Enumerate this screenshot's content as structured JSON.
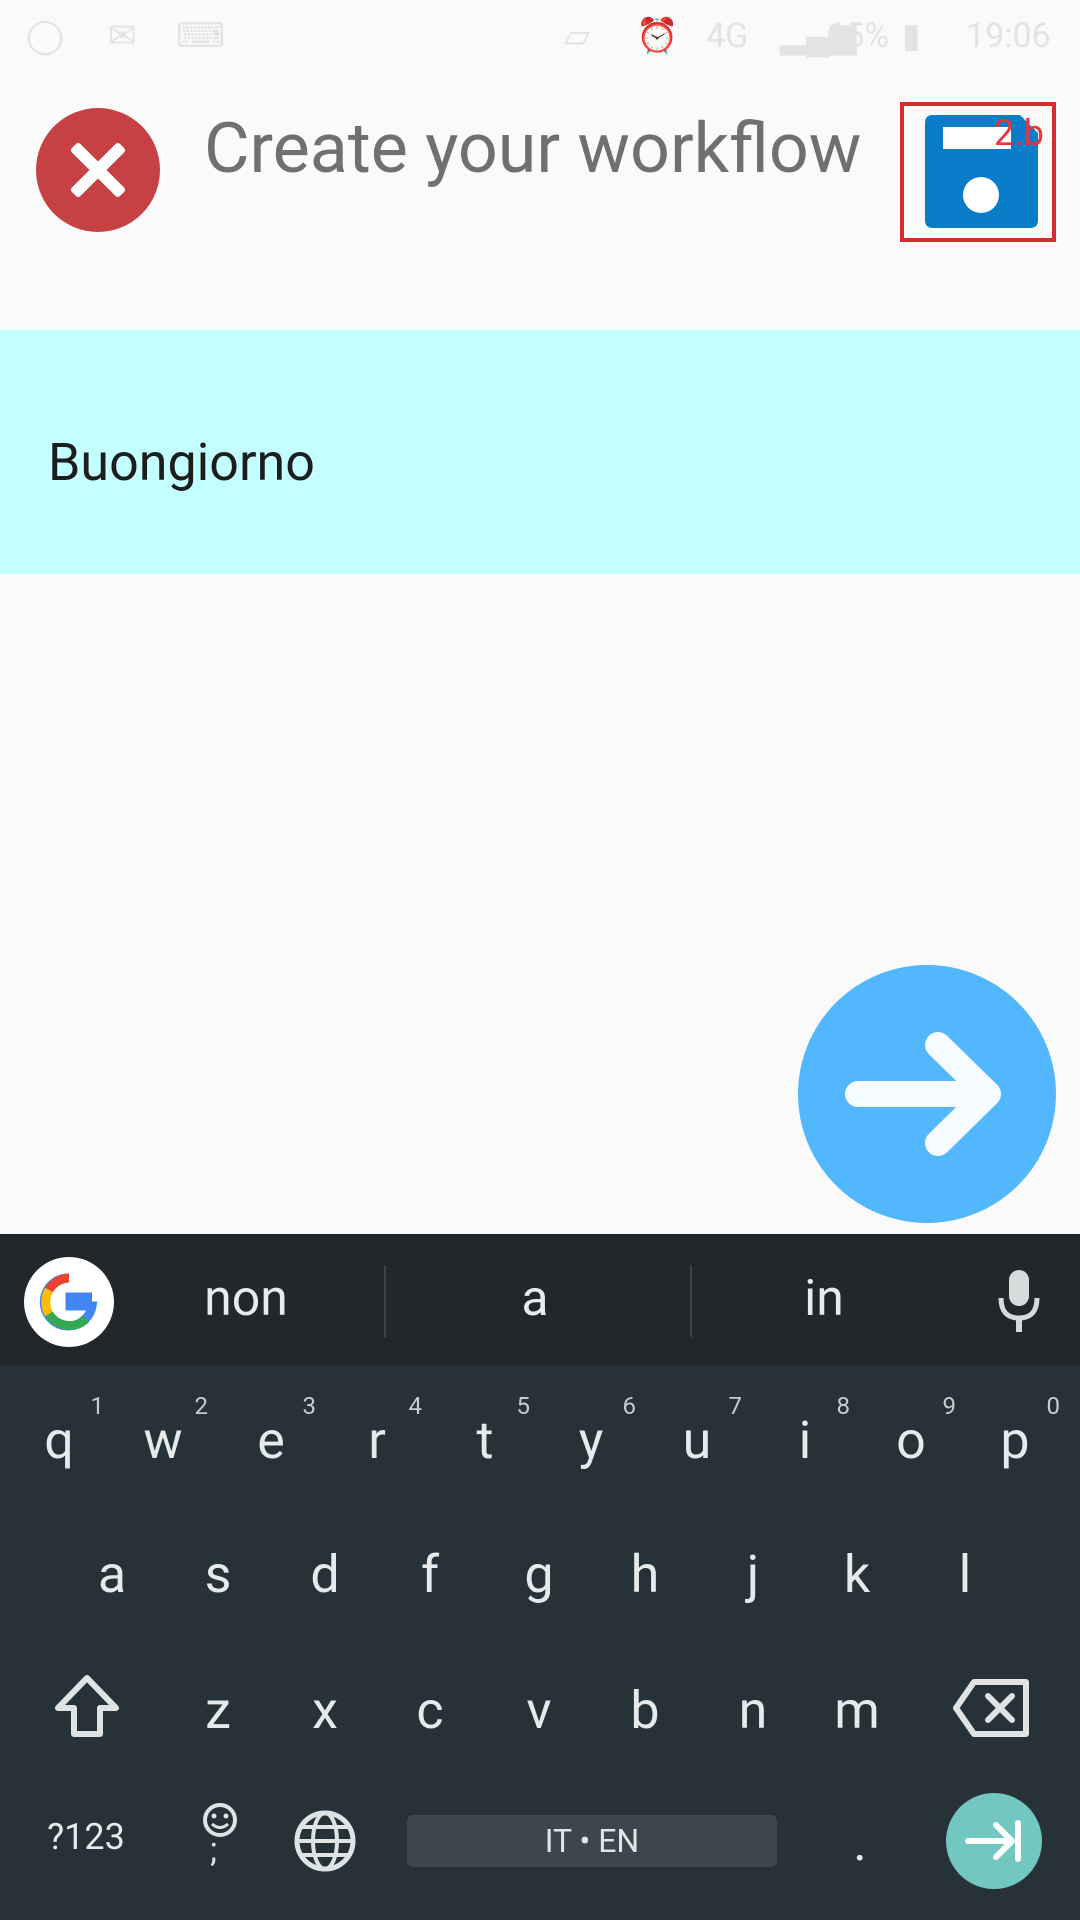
{
  "status_bar": {
    "network": "4G",
    "battery": "65%",
    "time": "19:06"
  },
  "header": {
    "title": "Create your workflow",
    "save_tag": "2.b"
  },
  "message": {
    "text": "Buongiorno"
  },
  "keyboard": {
    "suggestions": [
      "non",
      "a",
      "in"
    ],
    "row1": [
      {
        "key": "q",
        "num": "1"
      },
      {
        "key": "w",
        "num": "2"
      },
      {
        "key": "e",
        "num": "3"
      },
      {
        "key": "r",
        "num": "4"
      },
      {
        "key": "t",
        "num": "5"
      },
      {
        "key": "y",
        "num": "6"
      },
      {
        "key": "u",
        "num": "7"
      },
      {
        "key": "i",
        "num": "8"
      },
      {
        "key": "o",
        "num": "9"
      },
      {
        "key": "p",
        "num": "0"
      }
    ],
    "row2": [
      "a",
      "s",
      "d",
      "f",
      "g",
      "h",
      "j",
      "k",
      "l"
    ],
    "row3": [
      "z",
      "x",
      "c",
      "v",
      "b",
      "n",
      "m"
    ],
    "symbols_label": "?123",
    "emoji_label": ";",
    "space_label": "IT • EN",
    "period_label": "."
  },
  "colors": {
    "close": "#c64143",
    "save": "#0a7cc8",
    "message_bg": "#c4ffff",
    "fab": "#52b7fd",
    "enter": "#73c7c1"
  },
  "icons": [
    "close-icon",
    "save-icon",
    "arrow-right-icon",
    "google-icon",
    "mic-icon",
    "shift-icon",
    "backspace-icon",
    "globe-icon",
    "emoji-icon",
    "enter-icon"
  ]
}
